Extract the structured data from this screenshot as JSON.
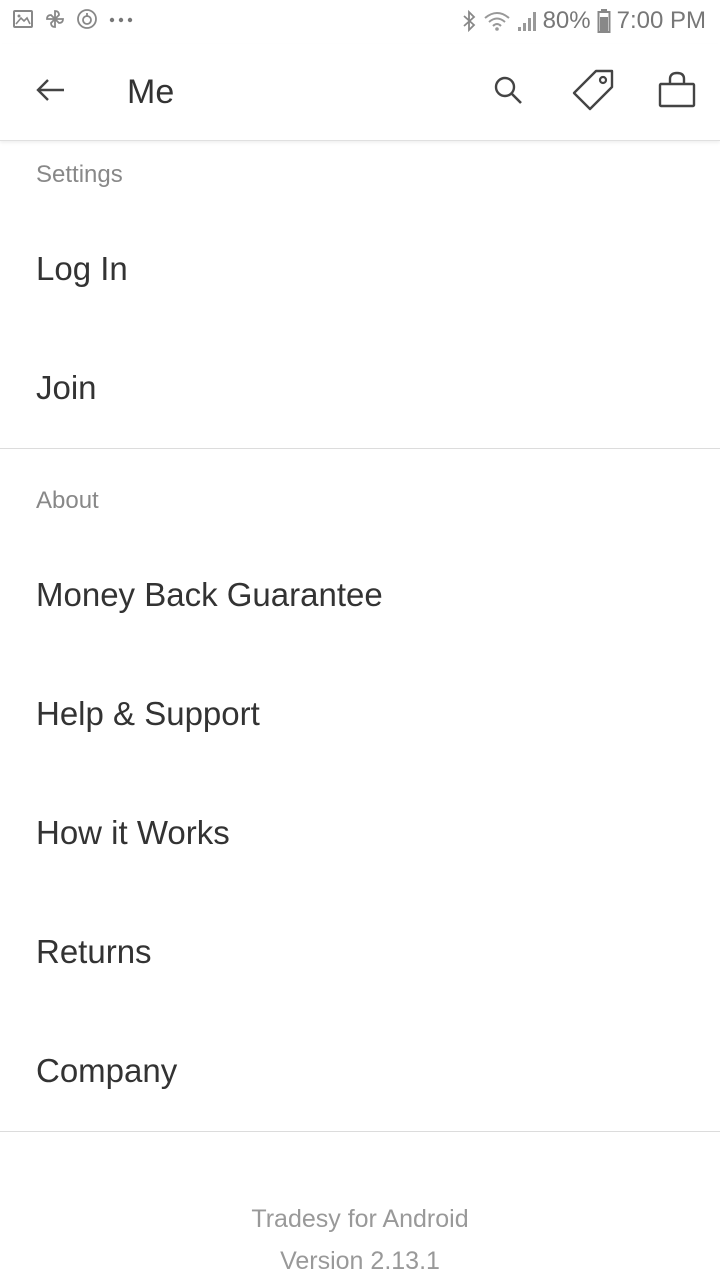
{
  "status_bar": {
    "icons_left": [
      "gallery-icon",
      "pinwheel-icon",
      "sync-icon",
      "more-dots-icon"
    ],
    "battery_text": "80%",
    "time": "7:00 PM",
    "icons_right": [
      "bluetooth-icon",
      "wifi-icon",
      "signal-icon",
      "battery-icon"
    ]
  },
  "app_bar": {
    "title": "Me",
    "icons": [
      "back-arrow-icon",
      "search-icon",
      "tag-icon",
      "shopping-bag-icon"
    ]
  },
  "sections": {
    "settings": {
      "header": "Settings",
      "items": [
        "Log In",
        "Join"
      ]
    },
    "about": {
      "header": "About",
      "items": [
        "Money Back Guarantee",
        "Help & Support",
        "How it Works",
        "Returns",
        "Company"
      ]
    }
  },
  "footer": {
    "app_name": "Tradesy for Android",
    "version": "Version 2.13.1"
  },
  "colors": {
    "background": "#ffffff",
    "text_primary": "#333333",
    "text_secondary": "#888888",
    "divider": "#dcdcdc"
  }
}
